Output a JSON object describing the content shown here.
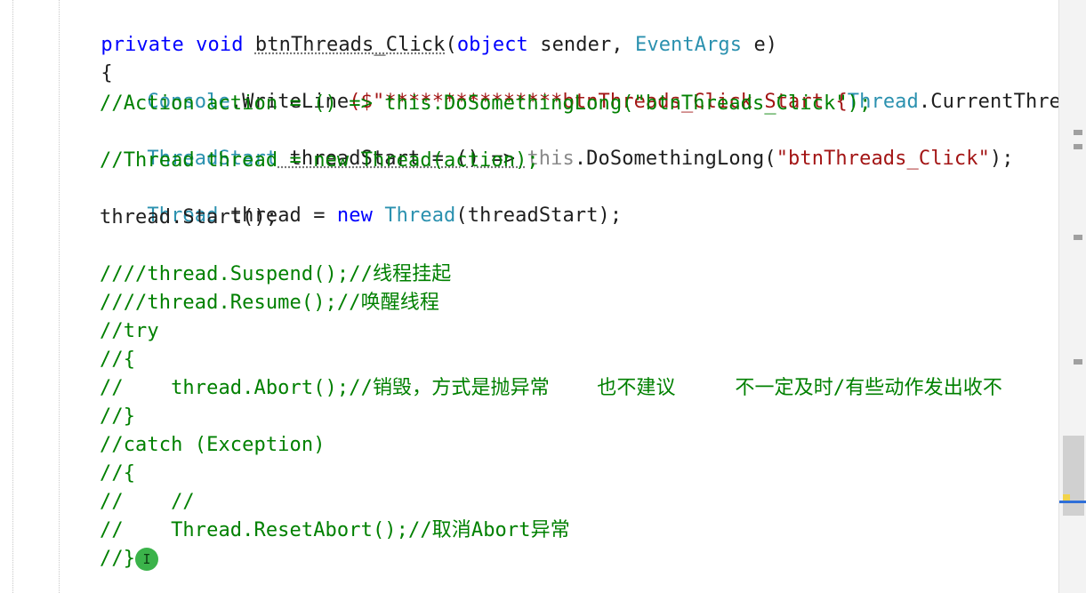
{
  "code": {
    "signature": {
      "modifier": "private",
      "ret": "void",
      "method": "btnThreads_Click",
      "open_paren": "(",
      "param1_type": "object",
      "param1_name": " sender, ",
      "param2_type": "EventArgs",
      "param2_name": " e)"
    },
    "open_brace": "{",
    "line1": {
      "class": "Console",
      "dot": ".",
      "method": "WriteLine",
      "open": "($\"",
      "str": "***************btnThreads_Click Start {",
      "thread_class": "Thread",
      "rest": ".CurrentThread.Ma"
    },
    "line2": "//Action action = () => this.DoSomethingLong(\"btnThreads_Click\");",
    "line3": {
      "type": "ThreadStart",
      "var": " threadStart = () => ",
      "this_kw": "this",
      "call": ".DoSomethingLong(",
      "str": "\"btnThreads_Click\"",
      "end": ");"
    },
    "line4": "//Thread thread = new Thread(action);",
    "line5": {
      "type": "Thread",
      "var": " thread = ",
      "new_kw": "new",
      "space": " ",
      "ctor": "Thread",
      "args": "(threadStart);"
    },
    "line6": "thread.Start();",
    "line7": "////thread.Suspend();//线程挂起",
    "line8": "////thread.Resume();//唤醒线程",
    "line9": "//try",
    "line10": "//{",
    "line11": "//    thread.Abort();//销毁，方式是抛异常    也不建议     不一定及时/有些动作发出收不",
    "line12": "//}",
    "line13": "//catch (Exception)",
    "line14": "//{",
    "line15": "//    //",
    "line16": "//    Thread.ResetAbort();//取消Abort异常",
    "line17": "//}"
  },
  "cursor_marker": "I",
  "colors": {
    "keyword": "#0000ff",
    "type": "#2b91af",
    "string": "#a31515",
    "comment": "#008000",
    "change_bar": "#2fa44f"
  }
}
